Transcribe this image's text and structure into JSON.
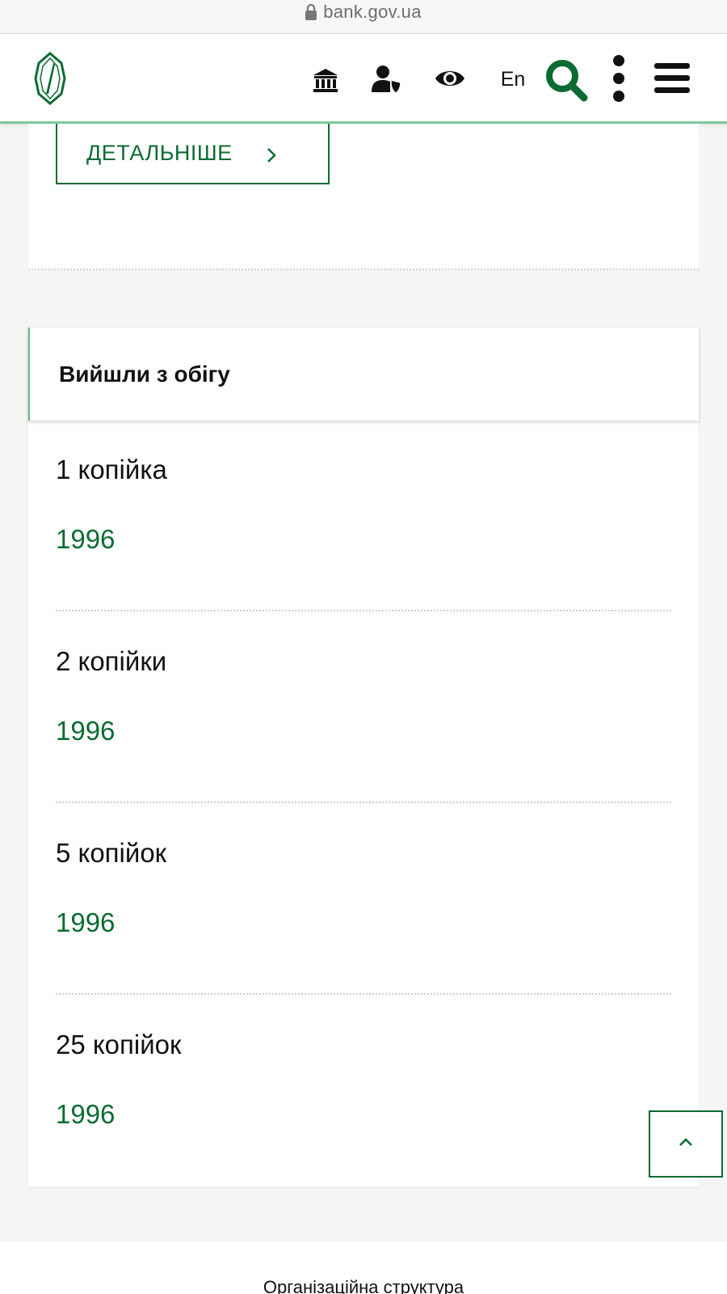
{
  "browser": {
    "url": "bank.gov.ua"
  },
  "header": {
    "lang_label": "En",
    "icons": [
      "bank-icon",
      "person-shield-icon",
      "eye-icon",
      "search-icon",
      "more-icon",
      "menu-icon"
    ],
    "brand_color": "#0b6b33",
    "accent_color": "#7cc99a"
  },
  "top_card": {
    "details_label": "ДЕТАЛЬНІШЕ"
  },
  "section": {
    "title": "Вийшли з обігу",
    "items": [
      {
        "name": "1 копійка",
        "year": "1996"
      },
      {
        "name": "2 копійки",
        "year": "1996"
      },
      {
        "name": "5 копійок",
        "year": "1996"
      },
      {
        "name": "25 копійок",
        "year": "1996"
      }
    ]
  },
  "footer": {
    "link_label": "Організаційна структура"
  }
}
